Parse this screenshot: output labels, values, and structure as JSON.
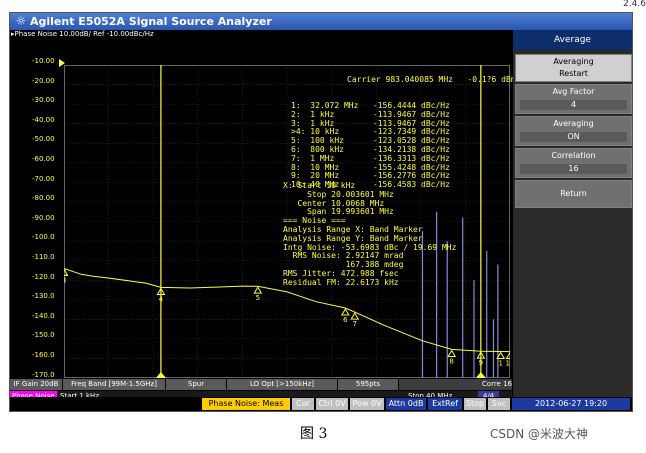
{
  "corner_text": "2.4.6",
  "window": {
    "title": "Agilent E5052A Signal Source Analyzer",
    "icon": "agilent-starburst-icon"
  },
  "screen": {
    "header": "▸Phase Noise 10.00dB/ Ref -10.00dBc/Hz",
    "y_axis_labels": [
      "-10.00",
      "-20.00",
      "-30.00",
      "-40.00",
      "-50.00",
      "-60.00",
      "-70.00",
      "-80.00",
      "-90.00",
      "-100.0",
      "-110.0",
      "-120.0",
      "-130.0",
      "-140.0",
      "-150.0",
      "-160.0",
      "-170.0"
    ],
    "carrier": "Carrier 983.040085 MHz   -0.1?6 dBm",
    "markers": [
      "1:  32.072 MHz   -156.4444 dBc/Hz",
      "2:  1 kHz        -113.9467 dBc/Hz",
      "3:  1 kHz        -113.9467 dBc/Hz",
      ">4: 10 kHz       -123.7349 dBc/Hz",
      "5:  100 kHz      -123.0528 dBc/Hz",
      "6:  800 kHz      -134.2138 dBc/Hz",
      "7:  1 MHz        -136.3313 dBc/Hz",
      "8:  10 MHz       -155.4248 dBc/Hz",
      "9:  20 MHz       -156.2776 dBc/Hz",
      "10: 40 MHz       -156.4583 dBc/Hz"
    ],
    "band_info": [
      "X: Start 10 kHz",
      "     Stop 20.003601 MHz",
      "   Center 10.0068 MHz",
      "     Span 19.993601 MHz",
      "=== Noise ===",
      "Analysis Range X: Band Marker",
      "Analysis Range Y: Band Marker",
      "Intg Noise: -53.6983 dBc / 19.69 MHz",
      "  RMS Noise: 2.92147 mrad",
      "             167.388 mdeg",
      "RMS Jitter: 472.988 fsec",
      "Residual FM: 22.6173 kHz"
    ],
    "softkeys": [
      "IF Gain 20dB",
      "Freq Band [99M-1.5GHz]",
      "Spur",
      "LO Opt [>150kHz]",
      "595pts",
      "Corre 16"
    ],
    "status": {
      "mode_label": "Phase Noise",
      "start": "Start 1 kHz",
      "stop": "Stop 40 MHz",
      "page": "4/4"
    }
  },
  "sidebar": {
    "title": "Average",
    "keys": [
      {
        "label": "Averaging",
        "value": "Restart"
      },
      {
        "label": "Avg Factor",
        "value": "4"
      },
      {
        "label": "Averaging",
        "value": "ON"
      },
      {
        "label": "Correlation",
        "value": "16"
      },
      {
        "label": "Return",
        "value": ""
      }
    ]
  },
  "bottom_status": {
    "meas": "Phase Noise: Meas",
    "items": [
      "Cor",
      "Ctrl 0V",
      "Pow 0V",
      "Attn 0dB",
      "ExtRef",
      "Stop",
      "Svc"
    ],
    "datetime": "2012-06-27 19:20"
  },
  "caption": "图 3",
  "watermark": "CSDN @米波大神",
  "colors": {
    "trace": "#ffff33",
    "screen_bg": "#000000",
    "title_bar": "#3a6bd0",
    "mode_badge": "#ff00ff",
    "meas_badge": "#ffcc00"
  },
  "chart_data": {
    "type": "line",
    "title": "Phase Noise 10.00dB/ Ref -10.00dBc/Hz",
    "xlabel": "",
    "ylabel": "",
    "xlim": [
      1000,
      40000000
    ],
    "ylim": [
      -170,
      -10
    ],
    "x_scale": "log",
    "grid": true,
    "series": [
      {
        "name": "",
        "x": [
          1000,
          1500,
          2000,
          3000,
          5000,
          7000,
          10000,
          20000,
          40000,
          70000,
          100000,
          200000,
          400000,
          800000,
          1000000,
          2000000,
          5000000,
          10000000,
          20000000,
          40000000
        ],
        "y": [
          -114,
          -117,
          -118,
          -119,
          -120.5,
          -121.5,
          -123.7,
          -124,
          -123.5,
          -123,
          -123.1,
          -126,
          -131,
          -134.2,
          -136.3,
          -143,
          -151,
          -155.4,
          -156.3,
          -156.5
        ]
      }
    ],
    "markers": [
      {
        "id": "1",
        "x": 32072000,
        "y": -156.4444
      },
      {
        "id": "2",
        "x": 1000,
        "y": -113.9467
      },
      {
        "id": "3",
        "x": 1000,
        "y": -113.9467
      },
      {
        "id": "4",
        "x": 10000,
        "y": -123.7349
      },
      {
        "id": "5",
        "x": 100000,
        "y": -123.0528
      },
      {
        "id": "6",
        "x": 800000,
        "y": -134.2138
      },
      {
        "id": "7",
        "x": 1000000,
        "y": -136.3313
      },
      {
        "id": "8",
        "x": 10000000,
        "y": -155.4248
      },
      {
        "id": "9",
        "x": 20000000,
        "y": -156.2776
      },
      {
        "id": "10",
        "x": 40000000,
        "y": -156.4583
      }
    ],
    "spurs": [
      {
        "x": 5000000,
        "y": -95
      },
      {
        "x": 7000000,
        "y": -85
      },
      {
        "x": 9000000,
        "y": -100
      },
      {
        "x": 13000000,
        "y": -88
      },
      {
        "x": 17000000,
        "y": -120
      },
      {
        "x": 23000000,
        "y": -105
      },
      {
        "x": 27000000,
        "y": -140
      },
      {
        "x": 30000000,
        "y": -112
      }
    ],
    "band_lines_x": [
      10000,
      20003601
    ]
  }
}
